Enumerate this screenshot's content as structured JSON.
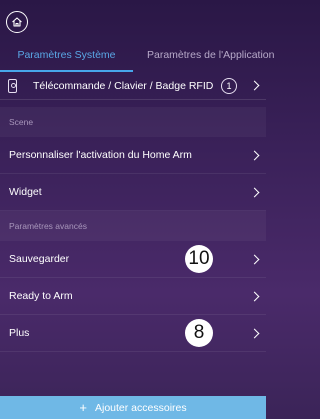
{
  "header": {
    "home_icon": "home-icon"
  },
  "tabs": [
    {
      "label": "Paramètres Système",
      "active": true
    },
    {
      "label": "Paramètres de l'Application",
      "active": false
    }
  ],
  "device_row": {
    "icon": "remote-icon",
    "label": "Télécommande / Clavier / Badge RFID",
    "count": "1"
  },
  "sections": {
    "scene": {
      "header": "Scene",
      "items": [
        "Personnaliser l'activation du Home Arm",
        "Widget"
      ]
    },
    "advanced": {
      "header": "Paramètres avancés",
      "items": [
        "Sauvegarder",
        "Ready to Arm",
        "Plus"
      ]
    }
  },
  "annotations": {
    "badge_sauvegarder": "10",
    "badge_plus": "8"
  },
  "footer": {
    "add_label": "Ajouter accessoires",
    "plus": "+"
  },
  "colors": {
    "active_tab": "#5aa7e6",
    "underline": "#47a6ea",
    "footer_bg": "#6fb8e6",
    "bg_top": "#2a1746",
    "bg_bottom": "#4a2a6a"
  }
}
